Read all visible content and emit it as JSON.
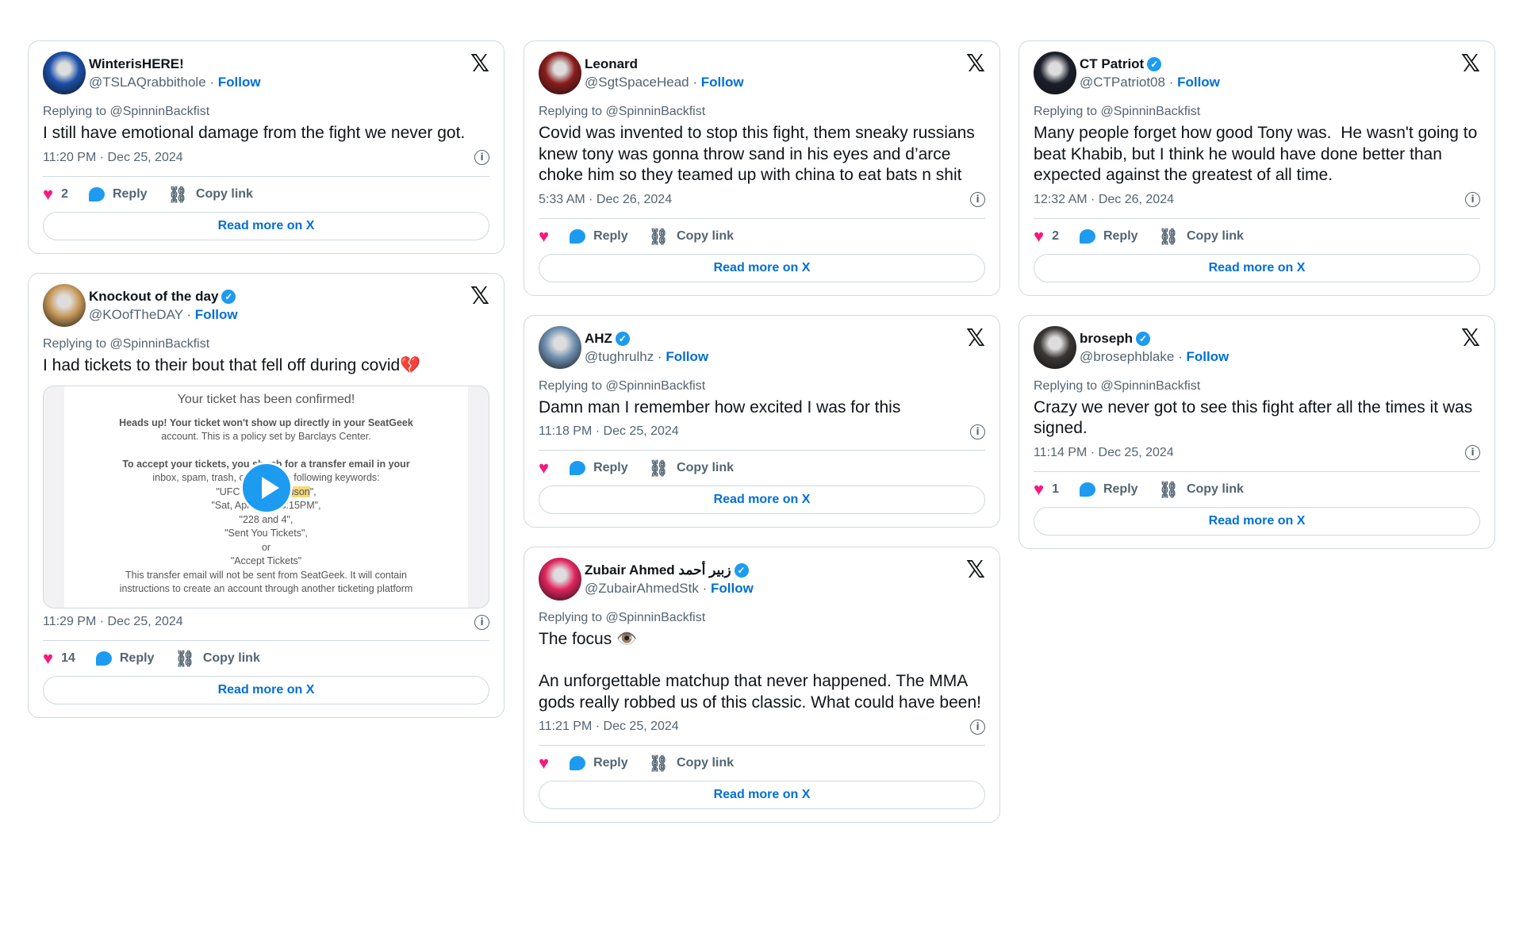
{
  "common": {
    "replying_prefix": "Replying to",
    "reply_label": "Reply",
    "copy_link_label": "Copy link",
    "read_more_label": "Read more on X",
    "follow_label": "Follow",
    "x_logo": "𝕏"
  },
  "colors": {
    "heart": "#f91880",
    "reply": "#1d9bf0",
    "link": "#006fd6",
    "verified": "#1d9bf0"
  },
  "columns": [
    [
      {
        "name": "WinterisHERE!",
        "verified": false,
        "handle": "@TSLAQrabbithole",
        "reply_to": "@SpinninBackfist",
        "text": "I still have emotional damage from the fight we never got.",
        "time": "11:20 PM · Dec 25, 2024",
        "likes": "2",
        "avatar_color": "#1b4fa8"
      },
      {
        "name": "Knockout of the day",
        "verified": true,
        "handle": "@KOofTheDAY",
        "reply_to": "@SpinninBackfist",
        "text": "I had tickets to their bout that fell off during covid💔",
        "time": "11:29 PM · Dec 25, 2024",
        "likes": "14",
        "avatar_color": "#c89a5a",
        "media": {
          "title": "Your ticket has been confirmed!",
          "lines": [
            "Heads up! Your ticket won't show up directly in your SeatGeek",
            "account. This is a policy set by Barclays Center.",
            "",
            "To accept your tickets, you sh      rch for a transfer email in your",
            "inbox, spam, trash, or junl          g the following keywords:",
            "\"UFC 249 -          Ferguson\",",
            "\"Sat, Apr 18,      at 6:15PM\",",
            "\"228 and 4\",",
            "\"Sent You Tickets\",",
            "or",
            "\"Accept Tickets\"",
            "This transfer email will not be sent from SeatGeek. It will contain",
            "instructions to create an account through another ticketing platform"
          ]
        }
      }
    ],
    [
      {
        "name": "Leonard",
        "verified": false,
        "handle": "@SgtSpaceHead",
        "reply_to": "@SpinninBackfist",
        "text": "Covid was invented to stop this fight, them sneaky russians knew tony was gonna throw sand in his eyes and d’arce choke him so they teamed up with china to eat bats n shit",
        "time": "5:33 AM · Dec 26, 2024",
        "likes": "",
        "avatar_color": "#8a1d1d"
      },
      {
        "name": "AHZ",
        "verified": true,
        "handle": "@tughrulhz",
        "reply_to": "@SpinninBackfist",
        "text": "Damn man I remember how excited I was for this",
        "time": "11:18 PM · Dec 25, 2024",
        "likes": "",
        "avatar_color": "#6f8fb0"
      },
      {
        "name": "Zubair Ahmed زبير أحمد",
        "verified": true,
        "handle": "@ZubairAhmedStk",
        "reply_to": "@SpinninBackfist",
        "text": "The focus 👁️\n\nAn unforgettable matchup that never happened. The MMA gods really robbed us of this classic. What could have been!",
        "time": "11:21 PM · Dec 25, 2024",
        "likes": "",
        "avatar_color": "#e0245e"
      }
    ],
    [
      {
        "name": "CT Patriot",
        "verified": true,
        "handle": "@CTPatriot08",
        "reply_to": "@SpinninBackfist",
        "text": "Many people forget how good Tony was.  He wasn't going to beat Khabib, but I think he would have done better than expected against the greatest of all time.",
        "time": "12:32 AM · Dec 26, 2024",
        "likes": "2",
        "avatar_color": "#1a1f2b"
      },
      {
        "name": "broseph",
        "verified": true,
        "handle": "@brosephblake",
        "reply_to": "@SpinninBackfist",
        "text": "Crazy we never got to see this fight after all the times it was signed.",
        "time": "11:14 PM · Dec 25, 2024",
        "likes": "1",
        "avatar_color": "#3a3633"
      }
    ]
  ]
}
